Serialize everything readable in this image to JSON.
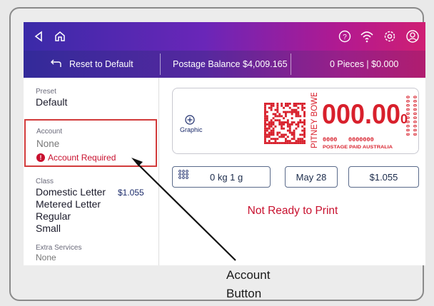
{
  "colors": {
    "accent_red": "#c8102e",
    "bar_start": "#3a2aa8",
    "bar_end": "#cf1f73",
    "stamp_red": "#d8202c"
  },
  "topbar": {
    "icons_left": [
      "back-icon",
      "home-icon"
    ],
    "icons_right": [
      "help-icon",
      "wifi-icon",
      "settings-icon",
      "account-circle-icon"
    ]
  },
  "subbar": {
    "reset_label": "Reset to Default",
    "balance_label": "Postage Balance $4,009.165",
    "pieces_label": "0 Pieces | $0.000"
  },
  "left": {
    "preset": {
      "label": "Preset",
      "value": "Default"
    },
    "account": {
      "label": "Account",
      "value": "None",
      "error": "Account Required"
    },
    "class": {
      "label": "Class",
      "line1": "Domestic Letter",
      "price": "$1.055",
      "line2": "Metered Letter",
      "line3": "Regular",
      "line4": "Small"
    },
    "extra_services": {
      "label": "Extra Services",
      "value": "None"
    }
  },
  "stamp": {
    "graphic_label": "Graphic",
    "brand": "PITNEY BOWES",
    "amount_main": "000.00",
    "amount_sub": "0",
    "meter_left": "0000",
    "meter_right": "0000000",
    "paid_text": "POSTAGE PAID AUSTRALIA",
    "side_digits": "0000000000",
    "side_digits_b": "0000000000"
  },
  "controls": {
    "weight": "0 kg 1 g",
    "date": "May 28",
    "amount": "$1.055",
    "status": "Not Ready to Print"
  },
  "annotation": {
    "line1": "Account",
    "line2": "Button"
  }
}
